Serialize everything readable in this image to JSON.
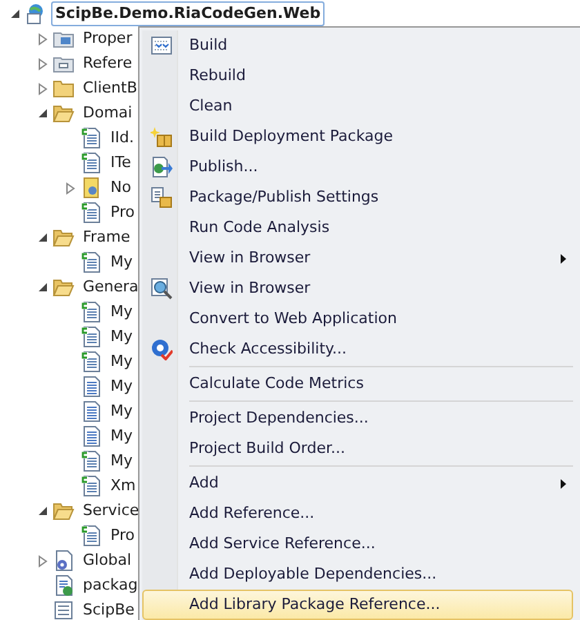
{
  "tree": {
    "label": "ScipBe.Demo.RiaCodeGen.Web",
    "kind": "project",
    "expanded": true,
    "selected": true,
    "children": [
      {
        "label": "Proper",
        "kind": "properties",
        "expanded": false,
        "selected": false
      },
      {
        "label": "Refere",
        "kind": "references",
        "expanded": false,
        "selected": false
      },
      {
        "label": "ClientB",
        "kind": "folder",
        "expanded": false,
        "selected": false
      },
      {
        "label": "Domai",
        "kind": "folder",
        "expanded": true,
        "selected": false,
        "children": [
          {
            "label": "IId.",
            "kind": "csharp-file",
            "selected": false
          },
          {
            "label": "ITe",
            "kind": "csharp-file",
            "selected": false
          },
          {
            "label": "No",
            "kind": "service-file",
            "expanded": false,
            "selected": false
          },
          {
            "label": "Pro",
            "kind": "csharp-file",
            "selected": false
          }
        ]
      },
      {
        "label": "Frame",
        "kind": "folder",
        "expanded": true,
        "selected": false,
        "children": [
          {
            "label": "My",
            "kind": "csharp-file",
            "selected": false
          }
        ]
      },
      {
        "label": "Genera",
        "kind": "folder",
        "expanded": true,
        "selected": false,
        "children": [
          {
            "label": "My",
            "kind": "csharp-file",
            "selected": false
          },
          {
            "label": "My",
            "kind": "csharp-file",
            "selected": false
          },
          {
            "label": "My",
            "kind": "csharp-file",
            "selected": false
          },
          {
            "label": "My",
            "kind": "text-file",
            "selected": false
          },
          {
            "label": "My",
            "kind": "text-file",
            "selected": false
          },
          {
            "label": "My",
            "kind": "text-file",
            "selected": false
          },
          {
            "label": "My",
            "kind": "csharp-file",
            "selected": false
          },
          {
            "label": "Xm",
            "kind": "csharp-file",
            "selected": false
          }
        ]
      },
      {
        "label": "Service",
        "kind": "folder",
        "expanded": true,
        "selected": false,
        "children": [
          {
            "label": "Pro",
            "kind": "csharp-file",
            "selected": false
          }
        ]
      },
      {
        "label": "Global",
        "kind": "global-file",
        "expanded": false,
        "selected": false
      },
      {
        "label": "packag",
        "kind": "package-file",
        "selected": false
      },
      {
        "label": "ScipBe",
        "kind": "form-file",
        "selected": false
      }
    ]
  },
  "context_menu": {
    "groups": [
      [
        {
          "label": "Build",
          "kind": "build",
          "submenu": false,
          "selected": false
        },
        {
          "label": "Rebuild",
          "kind": "plain",
          "submenu": false,
          "selected": false
        },
        {
          "label": "Clean",
          "kind": "plain",
          "submenu": false,
          "selected": false
        },
        {
          "label": "Build Deployment Package",
          "kind": "deploy",
          "submenu": false,
          "selected": false
        },
        {
          "label": "Publish...",
          "kind": "publish",
          "submenu": false,
          "selected": false
        },
        {
          "label": "Package/Publish Settings",
          "kind": "package-settings",
          "submenu": false,
          "selected": false
        },
        {
          "label": "Run Code Analysis",
          "kind": "plain",
          "submenu": false,
          "selected": false
        },
        {
          "label": "View in Browser",
          "kind": "plain",
          "submenu": true,
          "selected": false
        },
        {
          "label": "View in Browser",
          "kind": "browse",
          "submenu": false,
          "selected": false
        },
        {
          "label": "Convert to Web Application",
          "kind": "plain",
          "submenu": false,
          "selected": false
        },
        {
          "label": "Check Accessibility...",
          "kind": "accessibility",
          "submenu": false,
          "selected": false
        }
      ],
      [
        {
          "label": "Calculate Code Metrics",
          "kind": "plain",
          "submenu": false,
          "selected": false
        }
      ],
      [
        {
          "label": "Project Dependencies...",
          "kind": "plain",
          "submenu": false,
          "selected": false
        },
        {
          "label": "Project Build Order...",
          "kind": "plain",
          "submenu": false,
          "selected": false
        }
      ],
      [
        {
          "label": "Add",
          "kind": "plain",
          "submenu": true,
          "selected": false
        },
        {
          "label": "Add Reference...",
          "kind": "plain",
          "submenu": false,
          "selected": false
        },
        {
          "label": "Add Service Reference...",
          "kind": "plain",
          "submenu": false,
          "selected": false
        },
        {
          "label": "Add Deployable Dependencies...",
          "kind": "plain",
          "submenu": false,
          "selected": false
        },
        {
          "label": "Add Library Package Reference...",
          "kind": "plain",
          "submenu": false,
          "selected": true
        }
      ]
    ]
  }
}
